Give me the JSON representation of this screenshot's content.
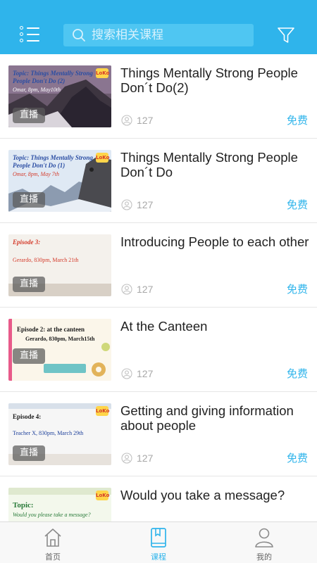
{
  "search": {
    "placeholder": "搜索相关课程"
  },
  "courses": [
    {
      "title": "Things Mentally Strong  People Don´t Do(2)",
      "thumb_topic": "Topic: Things Mentally Strong People Don't Do (2)",
      "thumb_sub": "Omar, 8pm, May10th",
      "badge": "直播",
      "count": "127",
      "price": "免费"
    },
    {
      "title": "Things Mentally Strong  People Don´t Do",
      "thumb_topic": "Topic: Things Mentally Strong People Don't Do (1)",
      "thumb_sub": "Omar, 8pm, May 7th",
      "badge": "直播",
      "count": "127",
      "price": "免费"
    },
    {
      "title": "Introducing People to each other",
      "thumb_topic": "Episode 3:",
      "thumb_sub": "Gerardo, 830pm, March 21th",
      "badge": "直播",
      "count": "127",
      "price": "免费"
    },
    {
      "title": "At the Canteen",
      "thumb_topic": "Episode 2:  at the canteen",
      "thumb_sub": "Gerardo, 830pm, March15th",
      "badge": "直播",
      "count": "127",
      "price": "免费"
    },
    {
      "title": "Getting and giving information about people",
      "thumb_topic": "Episode 4:",
      "thumb_sub": "Teacher X, 830pm, March 29th",
      "badge": "直播",
      "count": "127",
      "price": "免费"
    },
    {
      "title": "Would you take a message?",
      "thumb_topic": "Topic:",
      "thumb_sub": "Would you please take a message?",
      "badge": "",
      "count": "",
      "price": ""
    }
  ],
  "tabs": [
    {
      "label": "首页",
      "icon": "home-icon"
    },
    {
      "label": "课程",
      "icon": "book-icon"
    },
    {
      "label": "我的",
      "icon": "profile-icon"
    }
  ],
  "colors": {
    "accent": "#2fb4eb",
    "text": "#222222",
    "muted": "#a8a8a8"
  }
}
